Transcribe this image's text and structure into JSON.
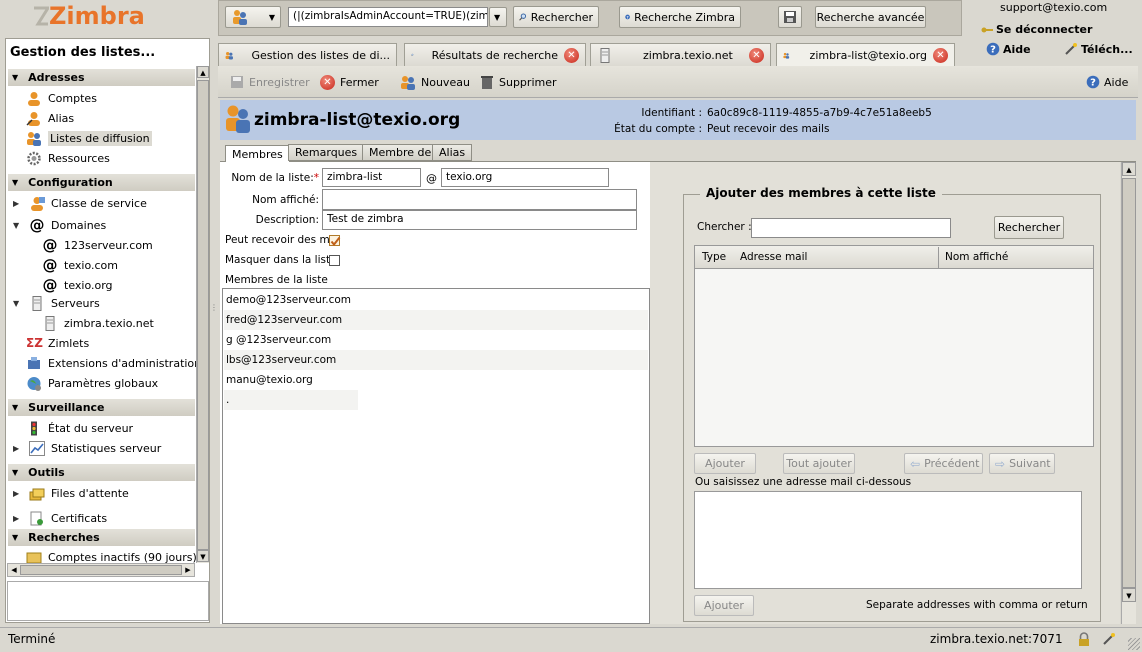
{
  "app": {
    "logo": "Zimbra",
    "status_text": "Terminé",
    "status_host": "zimbra.texio.net:7071"
  },
  "topbar": {
    "search_value": "(|(zimbraIsAdminAccount=TRUE)(zimb",
    "search_button": "Rechercher",
    "zimbra_search_button": "Recherche Zimbra",
    "advanced_search_button": "Recherche avancée",
    "user": "support@texio.com",
    "logout": "Se déconnecter",
    "help": "Aide",
    "download": "Téléch..."
  },
  "sidebar": {
    "title": "Gestion des listes...",
    "sections": {
      "addresses": "Adresses",
      "configuration": "Configuration",
      "monitoring": "Surveillance",
      "tools": "Outils",
      "searches": "Recherches"
    },
    "items": {
      "accounts": "Comptes",
      "aliases": "Alias",
      "distribution_lists": "Listes de diffusion",
      "resources": "Ressources",
      "cos": "Classe de service",
      "domains": "Domaines",
      "domain1": "123serveur.com",
      "domain2": "texio.com",
      "domain3": "texio.org",
      "servers": "Serveurs",
      "server1": "zimbra.texio.net",
      "zimlets": "Zimlets",
      "admin_ext": "Extensions d'administration",
      "global_settings": "Paramètres globaux",
      "server_status": "État du serveur",
      "server_stats": "Statistiques serveur",
      "queues": "Files d'attente",
      "certificates": "Certificats",
      "inactive_accounts": "Comptes inactifs (90 jours)"
    }
  },
  "tabs": [
    {
      "label": "Gestion des listes de di..."
    },
    {
      "label": "Résultats de recherche"
    },
    {
      "label": "zimbra.texio.net"
    },
    {
      "label": "zimbra-list@texio.org"
    }
  ],
  "toolbar": {
    "save": "Enregistrer",
    "close": "Fermer",
    "new": "Nouveau",
    "delete": "Supprimer",
    "help": "Aide"
  },
  "header": {
    "title": "zimbra-list@texio.org",
    "id_label": "Identifiant :",
    "id_value": "6a0c89c8-1119-4855-a7b9-4c7e51a8eeb5",
    "status_label": "État du compte :",
    "status_value": "Peut recevoir des mails"
  },
  "subtabs": [
    "Membres",
    "Remarques",
    "Membre de",
    "Alias"
  ],
  "form": {
    "list_name_label": "Nom de la liste:",
    "required_mark": "*",
    "list_name": "zimbra-list",
    "at": "@",
    "domain": "texio.org",
    "display_name_label": "Nom affiché:",
    "display_name": "",
    "description_label": "Description:",
    "description": "Test de zimbra",
    "can_receive_label": "Peut recevoir des m",
    "can_receive": true,
    "hide_label": "Masquer dans la list",
    "hide": false,
    "members_label": "Membres de la liste",
    "members": [
      "demo@123serveur.com",
      "fred@123serveur.com",
      "g        @123serveur.com",
      "lbs@123serveur.com",
      "manu@texio.org",
      "."
    ]
  },
  "add_panel": {
    "title": "Ajouter des membres à cette liste",
    "search_label": "Chercher :",
    "search_value": "",
    "search_button": "Rechercher",
    "col_type": "Type",
    "col_email": "Adresse mail",
    "col_display": "Nom affiché",
    "add_button": "Ajouter",
    "add_all_button": "Tout ajouter",
    "prev_button": "Précédent",
    "next_button": "Suivant",
    "manual_label": "Ou saisissez une adresse mail ci-dessous",
    "add_button2": "Ajouter",
    "hint": "Separate addresses with comma or return"
  }
}
